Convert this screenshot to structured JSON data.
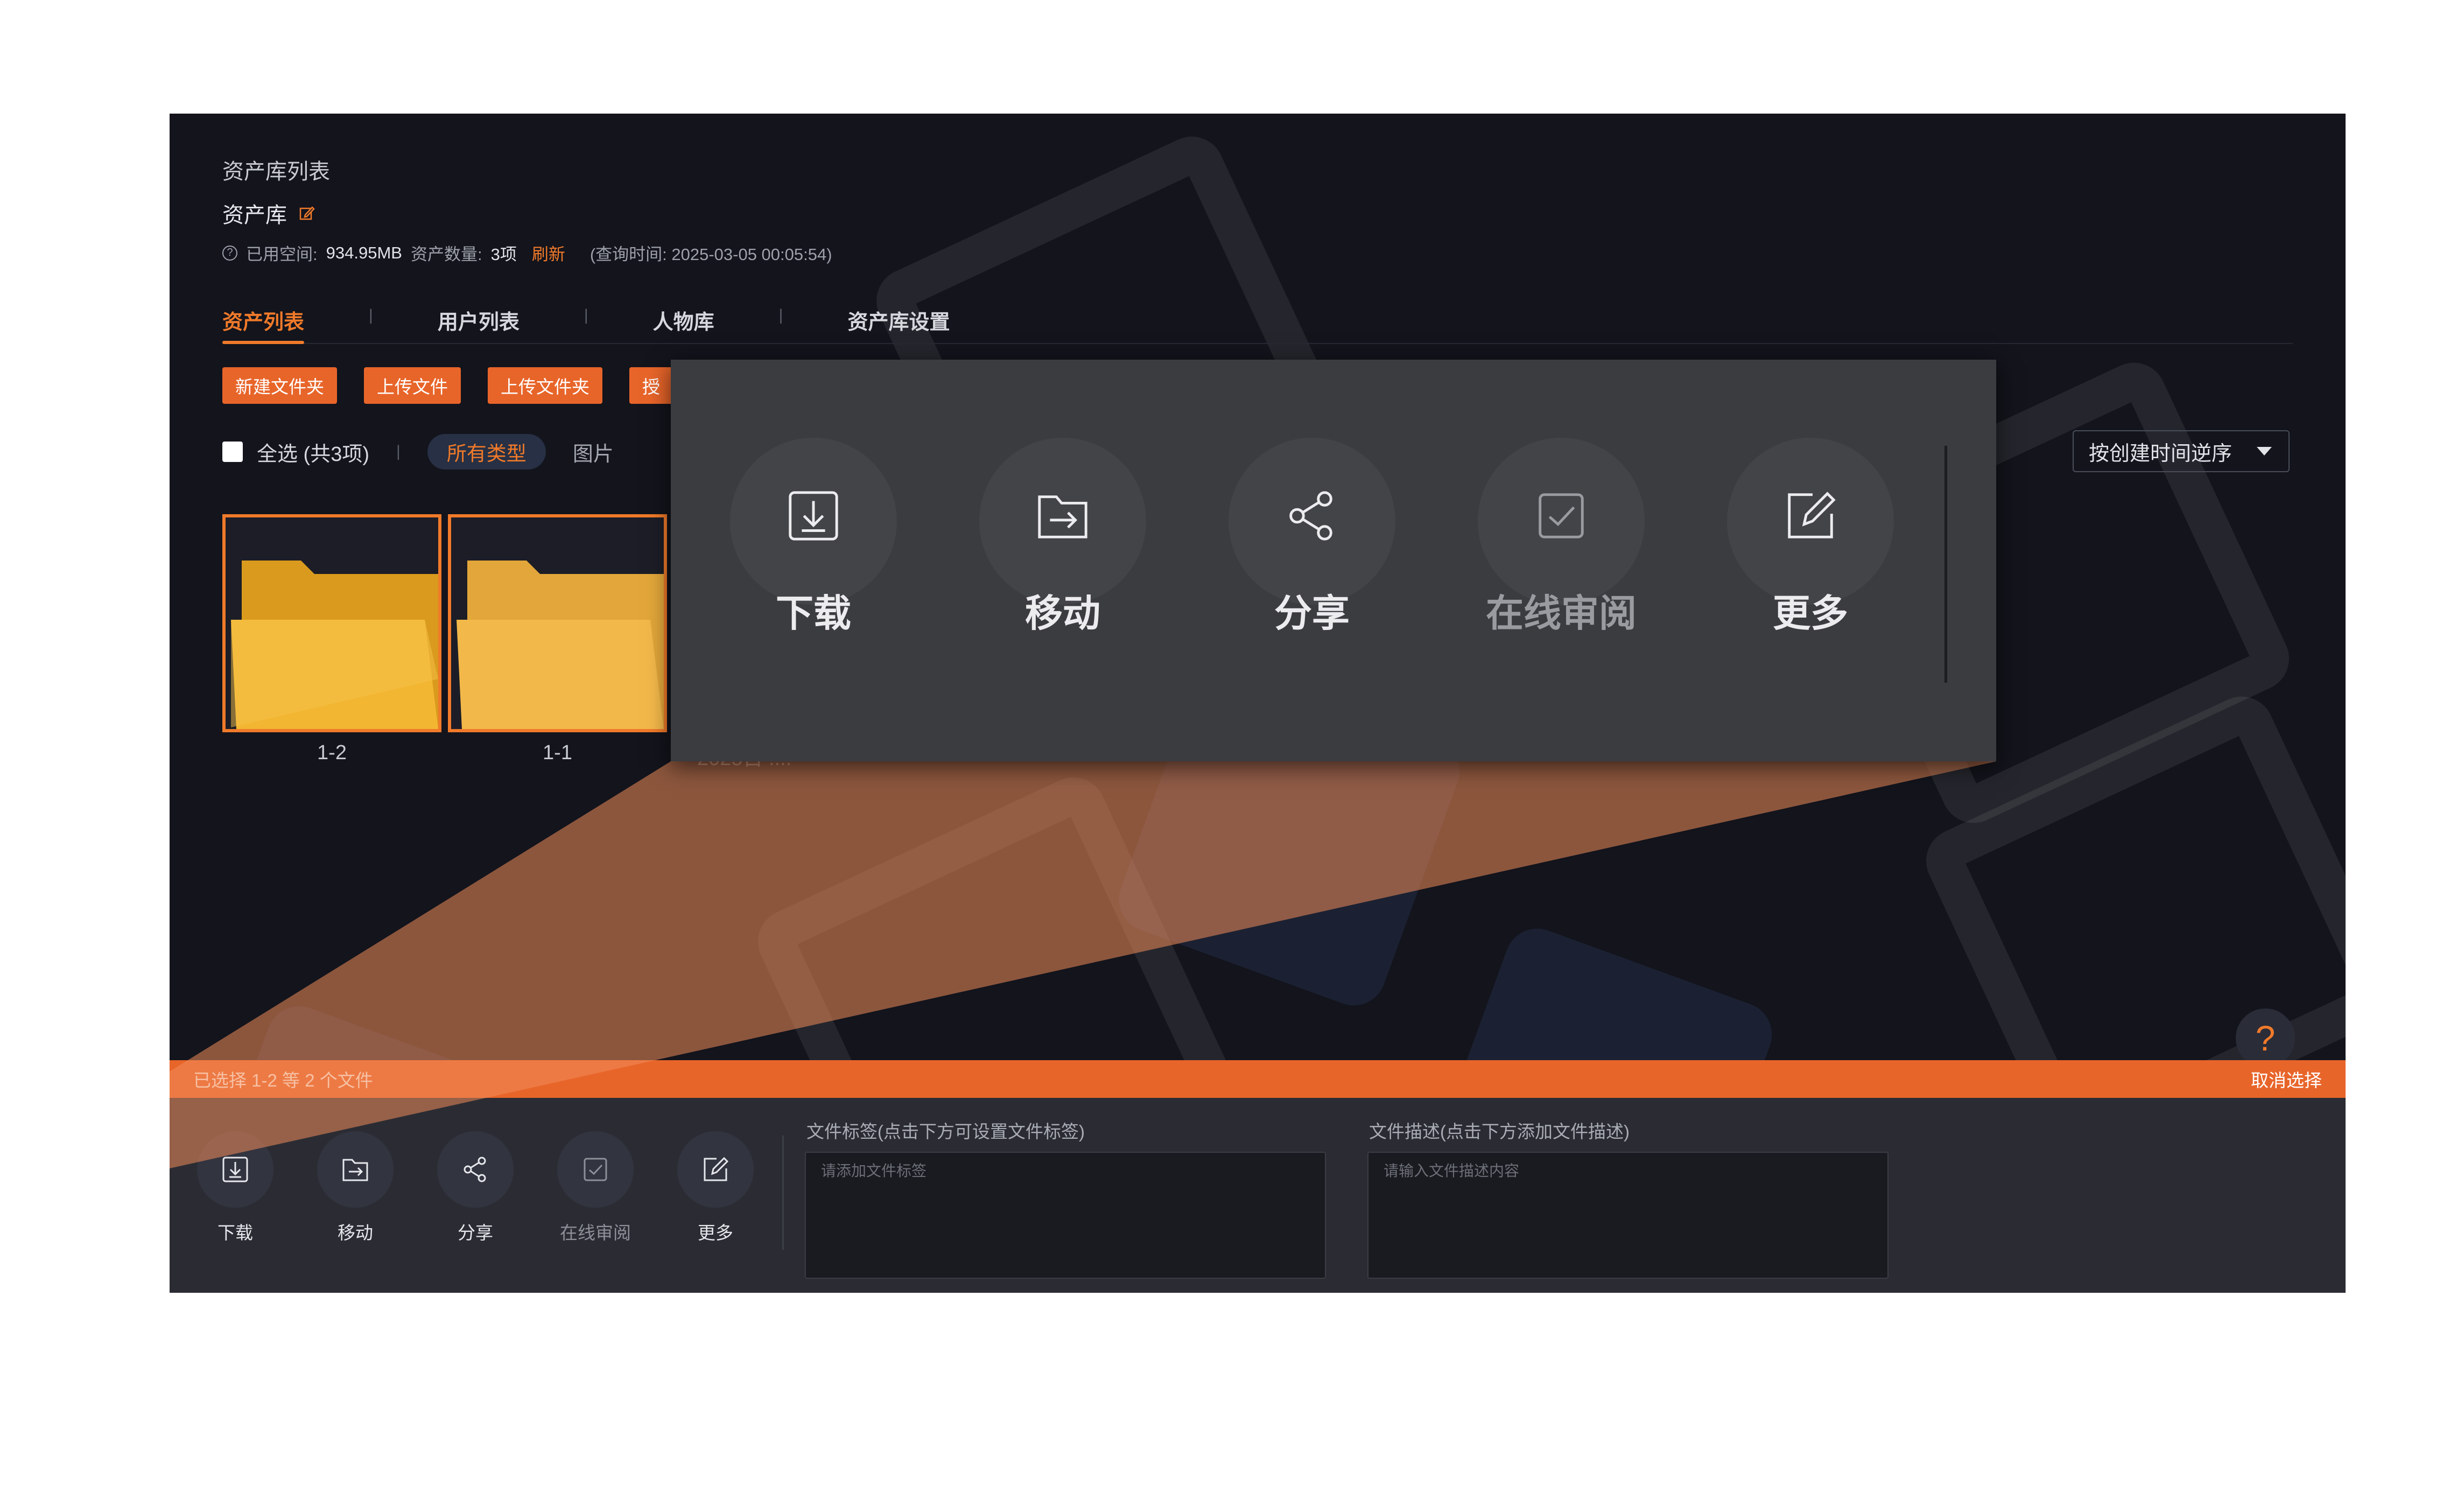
{
  "header": {
    "title": "资产库列表",
    "library_name": "资产库",
    "stats": {
      "used_space_label": "已用空间:",
      "used_space_value": "934.95MB",
      "asset_count_label": "资产数量:",
      "asset_count_value": "3项",
      "refresh_label": "刷新",
      "query_time": "(查询时间: 2025-03-05 00:05:54)"
    }
  },
  "tabs": [
    {
      "label": "资产列表",
      "active": true
    },
    {
      "label": "用户列表",
      "active": false
    },
    {
      "label": "人物库",
      "active": false
    },
    {
      "label": "资产库设置",
      "active": false
    }
  ],
  "toolbar": {
    "new_folder": "新建文件夹",
    "upload_file": "上传文件",
    "upload_folder": "上传文件夹",
    "truncated": "授"
  },
  "filter": {
    "select_all": "全选 (共3项)",
    "types": [
      "所有类型",
      "图片"
    ],
    "sort": "按创建时间逆序"
  },
  "files": [
    {
      "name": "1-2"
    },
    {
      "name": "1-1"
    }
  ],
  "hidden_date_text": "2025日 ....",
  "selection_bar": {
    "selected_text": "已选择 1-2 等 2 个文件",
    "cancel": "取消选择"
  },
  "bottom_actions": [
    {
      "label": "下载",
      "icon": "download-icon"
    },
    {
      "label": "移动",
      "icon": "move-icon"
    },
    {
      "label": "分享",
      "icon": "share-icon"
    },
    {
      "label": "在线审阅",
      "icon": "review-icon"
    },
    {
      "label": "更多",
      "icon": "edit-icon"
    }
  ],
  "tags_field": {
    "label": "文件标签(点击下方可设置文件标签)",
    "placeholder": "请添加文件标签"
  },
  "desc_field": {
    "label": "文件描述(点击下方添加文件描述)",
    "placeholder": "请输入文件描述内容"
  },
  "popup_actions": [
    {
      "label": "下载",
      "icon": "download-icon"
    },
    {
      "label": "移动",
      "icon": "move-icon"
    },
    {
      "label": "分享",
      "icon": "share-icon"
    },
    {
      "label": "在线审阅",
      "icon": "review-icon"
    },
    {
      "label": "更多",
      "icon": "edit-icon"
    }
  ],
  "help_label": "?",
  "colors": {
    "accent": "#f07a2a",
    "background": "#13141c",
    "panel": "#2b2c33",
    "folder": "#f3b335"
  }
}
